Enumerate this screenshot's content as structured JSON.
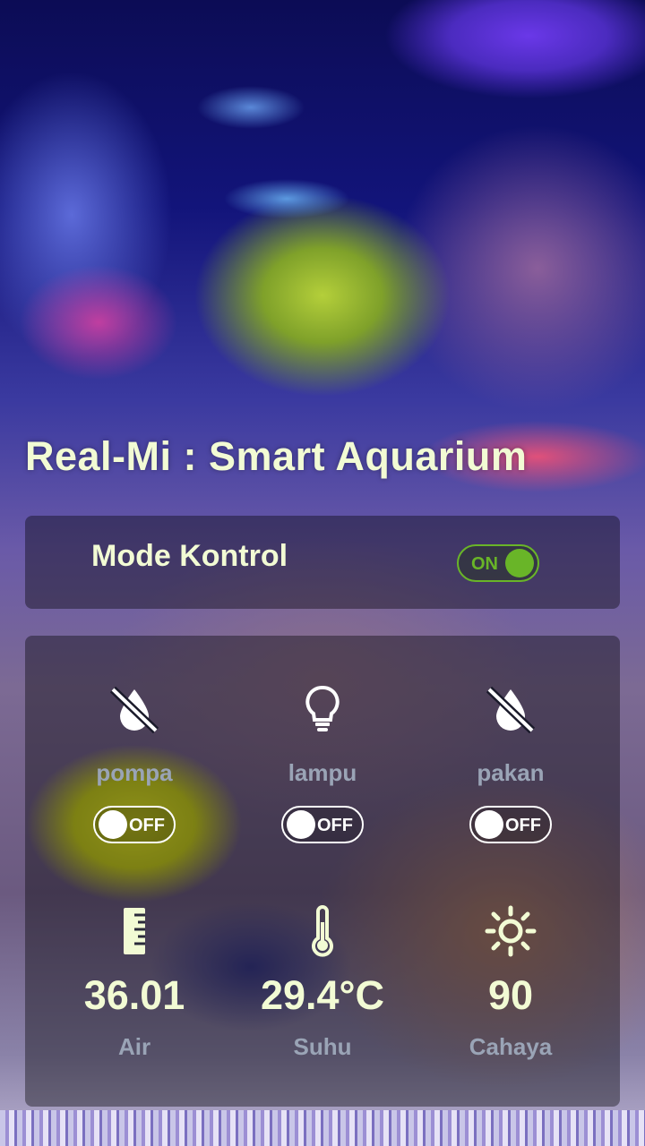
{
  "app": {
    "title": "Real-Mi : Smart Aquarium"
  },
  "mode": {
    "label": "Mode Kontrol",
    "switch_text": "ON",
    "state": "on"
  },
  "controls": [
    {
      "icon": "no-drop-icon",
      "label": "pompa",
      "switch_text": "OFF",
      "state": "off"
    },
    {
      "icon": "lightbulb-icon",
      "label": "lampu",
      "switch_text": "OFF",
      "state": "off"
    },
    {
      "icon": "no-drop-icon",
      "label": "pakan",
      "switch_text": "OFF",
      "state": "off"
    }
  ],
  "sensors": [
    {
      "icon": "ruler-icon",
      "value": "36.01",
      "label": "Air"
    },
    {
      "icon": "thermometer-icon",
      "value": "29.4°C",
      "label": "Suhu"
    },
    {
      "icon": "sun-icon",
      "value": "90",
      "label": "Cahaya"
    }
  ],
  "colors": {
    "title": "#f2fbd4",
    "label_gray": "#9aa4b6",
    "switch_on": "#69b528",
    "panel_bg": "rgba(0,0,0,0.38)"
  }
}
